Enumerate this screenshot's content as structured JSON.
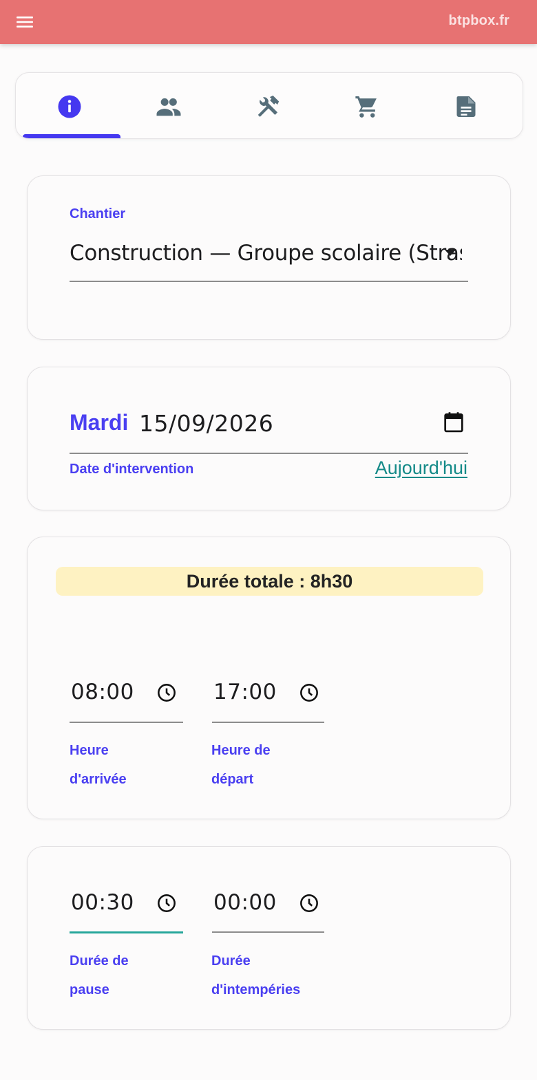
{
  "appbar": {
    "brand": "btpbox.fr",
    "menu_icon": "menu-icon",
    "color": "#e77272"
  },
  "tabs": [
    {
      "icon": "info-icon",
      "active": true
    },
    {
      "icon": "people-icon",
      "active": false
    },
    {
      "icon": "tools-icon",
      "active": false
    },
    {
      "icon": "cart-icon",
      "active": false
    },
    {
      "icon": "document-icon",
      "active": false
    }
  ],
  "chantier": {
    "label": "Chantier",
    "value": "Construction — Groupe scolaire (Strasbourg)"
  },
  "date": {
    "day": "Mardi",
    "value": "15/09/2026",
    "label": "Date d'intervention",
    "today_link": "Aujourd'hui"
  },
  "horaires": {
    "total": "Durée totale : 8h30",
    "arrivee": {
      "value": "08:00",
      "label_line1": "Heure",
      "label_line2": "d'arrivée"
    },
    "depart": {
      "value": "17:00",
      "label_line1": "Heure de",
      "label_line2": "départ"
    }
  },
  "pauses": {
    "pause": {
      "value": "00:30",
      "label_line1": "Durée de",
      "label_line2": "pause"
    },
    "intemperies": {
      "value": "00:00",
      "label_line1": "Durée",
      "label_line2": "d'intempéries"
    }
  },
  "colors": {
    "accent": "#4a3ff1",
    "link": "#148a88",
    "focus_underline": "#26a69a",
    "banner": "#fef2c2",
    "icon_grey": "#566e7a"
  }
}
